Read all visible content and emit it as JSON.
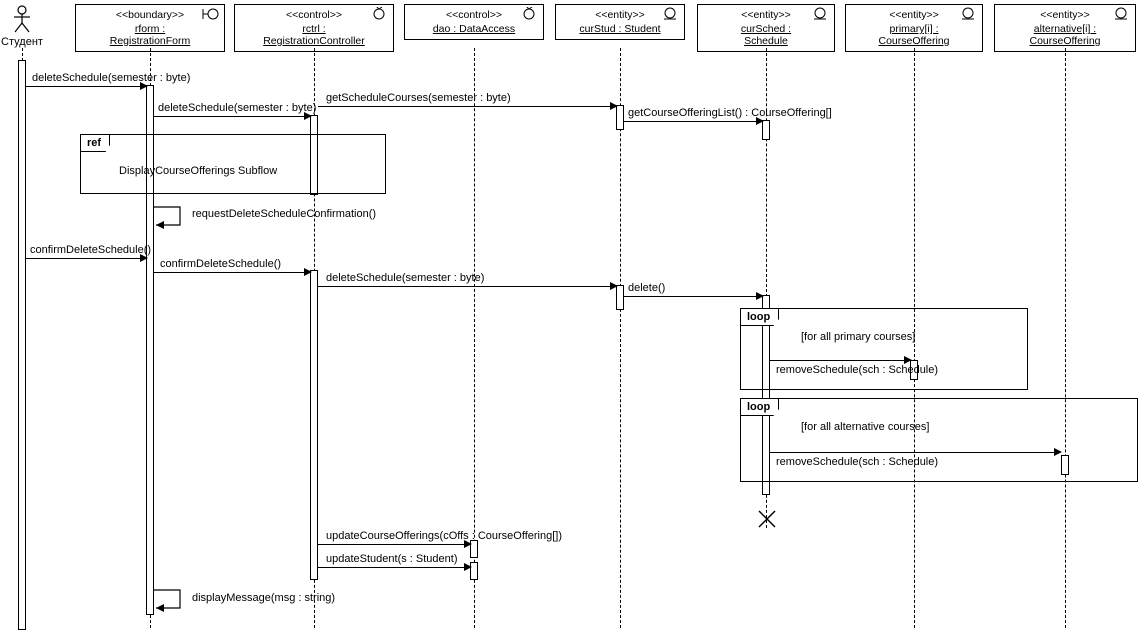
{
  "actor": {
    "label": "Студент"
  },
  "participants": {
    "rform": {
      "stereo": "<<boundary>>",
      "name": "rform :\nRegistrationForm"
    },
    "rctrl": {
      "stereo": "<<control>>",
      "name": "rctrl :\nRegistrationController"
    },
    "dao": {
      "stereo": "<<control>>",
      "name": "dao : DataAccess"
    },
    "curStud": {
      "stereo": "<<entity>>",
      "name": "curStud : Student"
    },
    "curSched": {
      "stereo": "<<entity>>",
      "name": "curSched :\nSchedule"
    },
    "primary": {
      "stereo": "<<entity>>",
      "name": "primary[i] :\nCourseOffering"
    },
    "alt": {
      "stereo": "<<entity>>",
      "name": "alternative[i] :\nCourseOffering"
    }
  },
  "messages": {
    "m1": "deleteSchedule(semester : byte)",
    "m2": "deleteSchedule(semester : byte)",
    "m3": "getScheduleCourses(semester : byte)",
    "m4": "getCourseOfferingList() : CourseOffering[]",
    "m5": "requestDeleteScheduleConfirmation()",
    "m6": "confirmDeleteSchedule()",
    "m7": "confirmDeleteSchedule()",
    "m8": "deleteSchedule(semester : byte)",
    "m9": "delete()",
    "m10": "removeSchedule(sch : Schedule)",
    "m11": "removeSchedule(sch : Schedule)",
    "m12": "updateCourseOfferings(cOffs : CourseOffering[])",
    "m13": "updateStudent(s : Student)",
    "m14": "displayMessage(msg : string)"
  },
  "fragments": {
    "ref": {
      "label": "ref",
      "text": "DisplayCourseOfferings Subflow"
    },
    "loop1": {
      "label": "loop",
      "guard": "[for all primary courses]"
    },
    "loop2": {
      "label": "loop",
      "guard": "[for all alternative courses]"
    }
  },
  "chart_data": {
    "type": "uml-sequence",
    "actor": "Студент",
    "participants": [
      {
        "id": "rform",
        "stereotype": "boundary",
        "name": "rform : RegistrationForm"
      },
      {
        "id": "rctrl",
        "stereotype": "control",
        "name": "rctrl : RegistrationController"
      },
      {
        "id": "dao",
        "stereotype": "control",
        "name": "dao : DataAccess"
      },
      {
        "id": "curStud",
        "stereotype": "entity",
        "name": "curStud : Student"
      },
      {
        "id": "curSched",
        "stereotype": "entity",
        "name": "curSched : Schedule"
      },
      {
        "id": "primary",
        "stereotype": "entity",
        "name": "primary[i] : CourseOffering"
      },
      {
        "id": "alt",
        "stereotype": "entity",
        "name": "alternative[i] : CourseOffering"
      }
    ],
    "interactions": [
      {
        "from": "Студент",
        "to": "rform",
        "label": "deleteSchedule(semester : byte)"
      },
      {
        "from": "rform",
        "to": "rctrl",
        "label": "deleteSchedule(semester : byte)"
      },
      {
        "from": "rctrl",
        "to": "curStud",
        "label": "getScheduleCourses(semester : byte)"
      },
      {
        "from": "curStud",
        "to": "curSched",
        "label": "getCourseOfferingList() : CourseOffering[]"
      },
      {
        "fragment": "ref",
        "text": "DisplayCourseOfferings Subflow",
        "covers": [
          "rform",
          "rctrl"
        ]
      },
      {
        "from": "rform",
        "to": "rform",
        "label": "requestDeleteScheduleConfirmation()",
        "self": true
      },
      {
        "from": "Студент",
        "to": "rform",
        "label": "confirmDeleteSchedule()"
      },
      {
        "from": "rform",
        "to": "rctrl",
        "label": "confirmDeleteSchedule()"
      },
      {
        "from": "rctrl",
        "to": "curStud",
        "label": "deleteSchedule(semester : byte)"
      },
      {
        "from": "curStud",
        "to": "curSched",
        "label": "delete()"
      },
      {
        "fragment": "loop",
        "guard": "[for all primary courses]",
        "messages": [
          {
            "from": "curSched",
            "to": "primary",
            "label": "removeSchedule(sch : Schedule)"
          }
        ]
      },
      {
        "fragment": "loop",
        "guard": "[for all alternative courses]",
        "messages": [
          {
            "from": "curSched",
            "to": "alt",
            "label": "removeSchedule(sch : Schedule)"
          }
        ]
      },
      {
        "destroy": "curSched"
      },
      {
        "from": "rctrl",
        "to": "dao",
        "label": "updateCourseOfferings(cOffs : CourseOffering[])"
      },
      {
        "from": "rctrl",
        "to": "dao",
        "label": "updateStudent(s : Student)"
      },
      {
        "from": "rform",
        "to": "rform",
        "label": "displayMessage(msg : string)",
        "self": true
      }
    ]
  }
}
